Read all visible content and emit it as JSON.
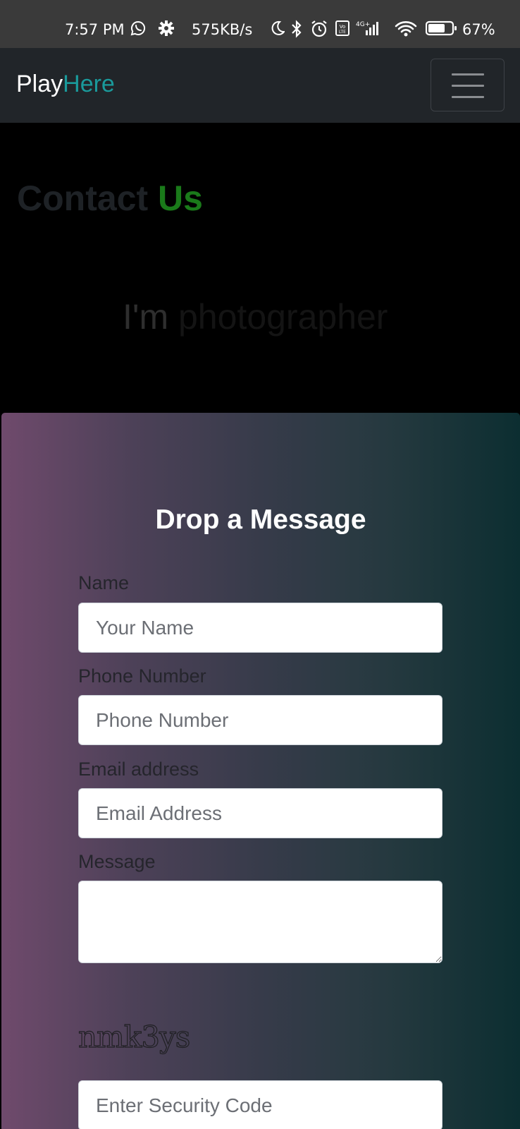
{
  "status_bar": {
    "time": "7:57 PM",
    "speed": "575KB/s",
    "battery": "67%",
    "icons": [
      "whatsapp-icon",
      "settings-icon",
      "moon-icon",
      "bluetooth-icon",
      "alarm-icon",
      "volte-icon",
      "signal-icon",
      "wifi-icon",
      "battery-icon"
    ]
  },
  "navbar": {
    "brand_part1": "Play",
    "brand_part2": "Here",
    "brand_accent_color": "#1a9a9b",
    "toggle_icon": "hamburger-menu-icon"
  },
  "hero": {
    "title_part1": "Contact",
    "title_part2": "Us",
    "subtitle_part1": "I'm",
    "subtitle_part2": "photographer"
  },
  "form": {
    "title": "Drop a Message",
    "fields": {
      "name": {
        "label": "Name",
        "placeholder": "Your Name",
        "value": ""
      },
      "phone": {
        "label": "Phone Number",
        "placeholder": "Phone Number",
        "value": ""
      },
      "email": {
        "label": "Email address",
        "placeholder": "Email Address",
        "value": ""
      },
      "message": {
        "label": "Message",
        "placeholder": "",
        "value": ""
      }
    },
    "captcha_text": "nmk3ys",
    "security_code": {
      "placeholder": "Enter Security Code",
      "value": ""
    }
  }
}
